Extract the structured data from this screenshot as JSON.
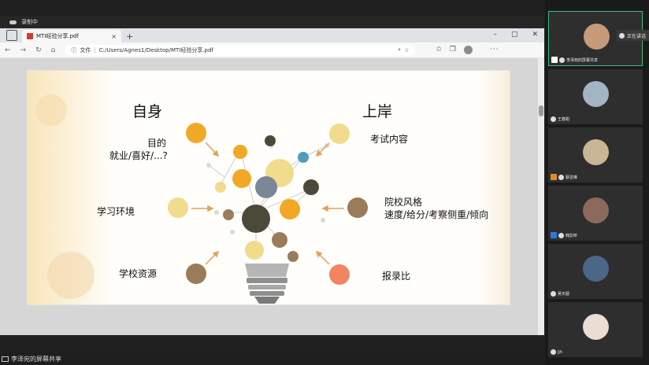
{
  "recording": {
    "label": "录制中"
  },
  "browser": {
    "tab_title": "MTI经验分享.pdf",
    "tab_close": "×",
    "new_tab": "+",
    "win_min": "–",
    "win_max": "▢",
    "win_close": "✕",
    "url_prefix": "文件",
    "url": "C:/Users/Agnes1/Desktop/MTI经验分享.pdf"
  },
  "slide": {
    "title_left": "自身",
    "title_right": "上岸",
    "labels": {
      "goal": "目的",
      "goal_sub": "就业/喜好/...?",
      "env": "学习环境",
      "resources": "学校资源",
      "content": "考试内容",
      "style": "院校风格",
      "style_sub": "速度/给分/考察侧重/倾向",
      "ratio": "报录比"
    }
  },
  "share_label": "李泽宛的屏幕共享",
  "panel": {
    "speaking": "正在讲话",
    "cards": [
      {
        "name": "李泽宛的屏幕共享",
        "avatar_color": "#c59a7a"
      },
      {
        "name": "王春甜",
        "avatar_color": "#a3b4c3"
      },
      {
        "name": "蔡昱琳",
        "avatar_color": "#c8b694"
      },
      {
        "name": "韩彭昕",
        "avatar_color": "#8b6a5c"
      },
      {
        "name": "吴天骏",
        "avatar_color": "#4c6688"
      },
      {
        "name": "Jjh",
        "avatar_color": "#e9ddd4"
      }
    ]
  },
  "colors": {
    "orange": "#f2a825",
    "yellow_light": "#f0dc8c",
    "olive": "#4b4a38",
    "brown": "#9a7c5a",
    "teal": "#4aa0b8",
    "coral": "#f38460",
    "slate": "#7a8796"
  }
}
